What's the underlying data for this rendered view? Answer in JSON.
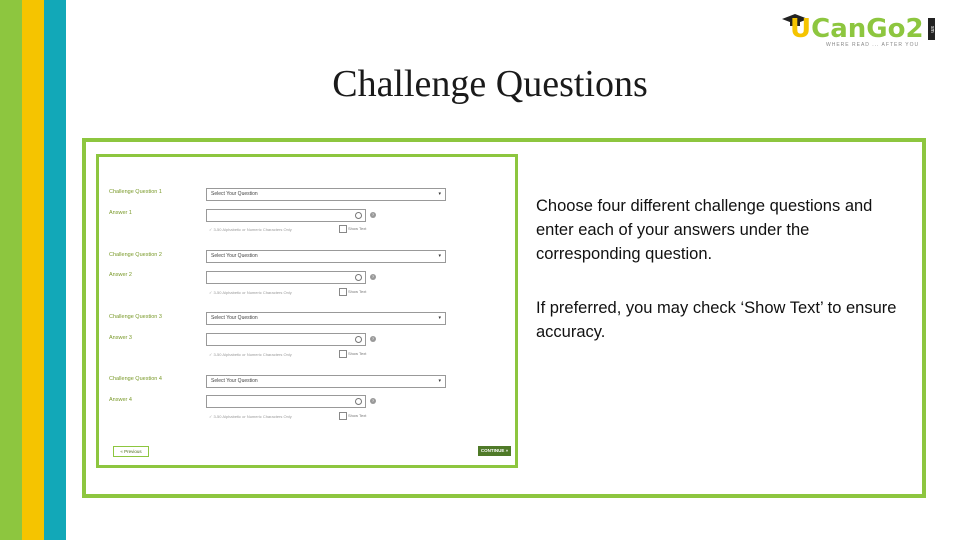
{
  "title": "Challenge Questions",
  "logo": {
    "part1": "U",
    "part2": "Can",
    "part3": "Go2",
    "tagline": "WHERE READ ... AFTER YOU",
    "side": "sm"
  },
  "form": {
    "blocks": [
      {
        "question_label": "Challenge Question 1",
        "question_value": "Select Your Question",
        "answer_label": "Answer 1",
        "hint": "✓ 3-50 Alphabetic or Numeric Characters Only",
        "show_text": "Show Text"
      },
      {
        "question_label": "Challenge Question 2",
        "question_value": "Select Your Question",
        "answer_label": "Answer 2",
        "hint": "✓ 3-50 Alphabetic or Numeric Characters Only",
        "show_text": "Show Text"
      },
      {
        "question_label": "Challenge Question 3",
        "question_value": "Select Your Question",
        "answer_label": "Answer 3",
        "hint": "✓ 3-50 Alphabetic or Numeric Characters Only",
        "show_text": "Show Text"
      },
      {
        "question_label": "Challenge Question 4",
        "question_value": "Select Your Question",
        "answer_label": "Answer 4",
        "hint": "✓ 3-50 Alphabetic or Numeric Characters Only",
        "show_text": "Show Text"
      }
    ],
    "previous_label": "« Previous",
    "continue_label": "CONTINUE »"
  },
  "instructions": {
    "paragraph1": "Choose four different challenge questions and enter each of your answers under the corresponding question.",
    "paragraph2": "If preferred, you may check ‘Show Text’ to ensure accuracy."
  },
  "colors": {
    "green": "#8dc63f",
    "yellow": "#f5c400",
    "teal": "#12a8b8",
    "button_green": "#4f7a28"
  }
}
